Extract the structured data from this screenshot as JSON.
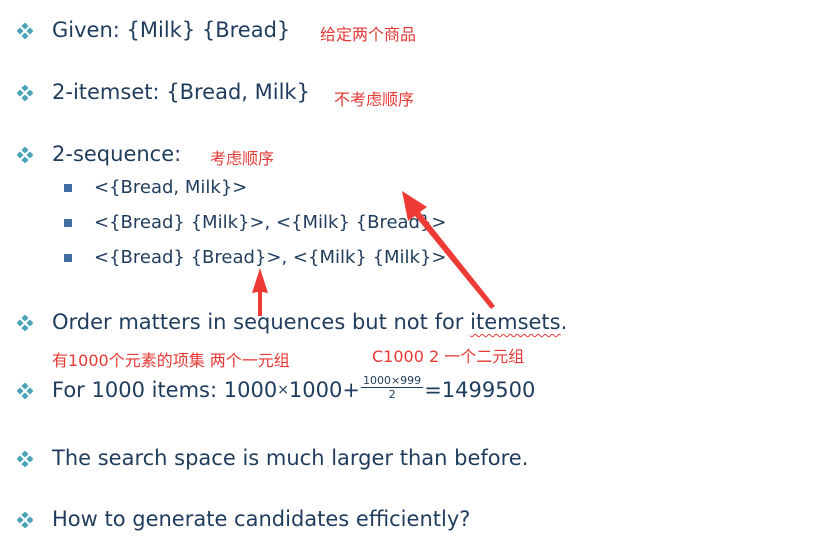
{
  "bullets": {
    "given": {
      "text": "Given: {Milk}  {Bread}",
      "note": "给定两个商品"
    },
    "itemset": {
      "text": "2-itemset: {Bread, Milk}",
      "note": "不考虑顺序"
    },
    "sequence": {
      "text": "2-sequence:",
      "note": "考虑顺序",
      "subitems": [
        "<{Bread, Milk}>",
        "<{Bread} {Milk}>, <{Milk} {Bread}>",
        "<{Bread} {Bread}>, <{Milk} {Milk}>"
      ]
    },
    "order": {
      "text_main": "Order matters in sequences but not for ",
      "text_underlined": "itemsets",
      "text_end": ".",
      "note_left": "有1000个元素的项集 两个一元组",
      "note_right": "C1000 2 一个二元组"
    },
    "formula": {
      "prefix": "For 1000 items: 1000",
      "times": "×",
      "mid": "1000+",
      "frac_num": "1000×999",
      "frac_den": "2",
      "suffix": "=1499500"
    },
    "search": {
      "text": "The search space is much larger than before."
    },
    "generate": {
      "text": "How to generate candidates efficiently?"
    }
  },
  "colors": {
    "text": "#1f3c5c",
    "note": "#e53935",
    "bullet": "#4aa3b8",
    "sub_bullet": "#3f6ea3",
    "arrow": "#ef3b36"
  },
  "icons": {
    "main_bullet": "four-diamond-icon",
    "sub_bullet": "square-bullet-icon"
  }
}
